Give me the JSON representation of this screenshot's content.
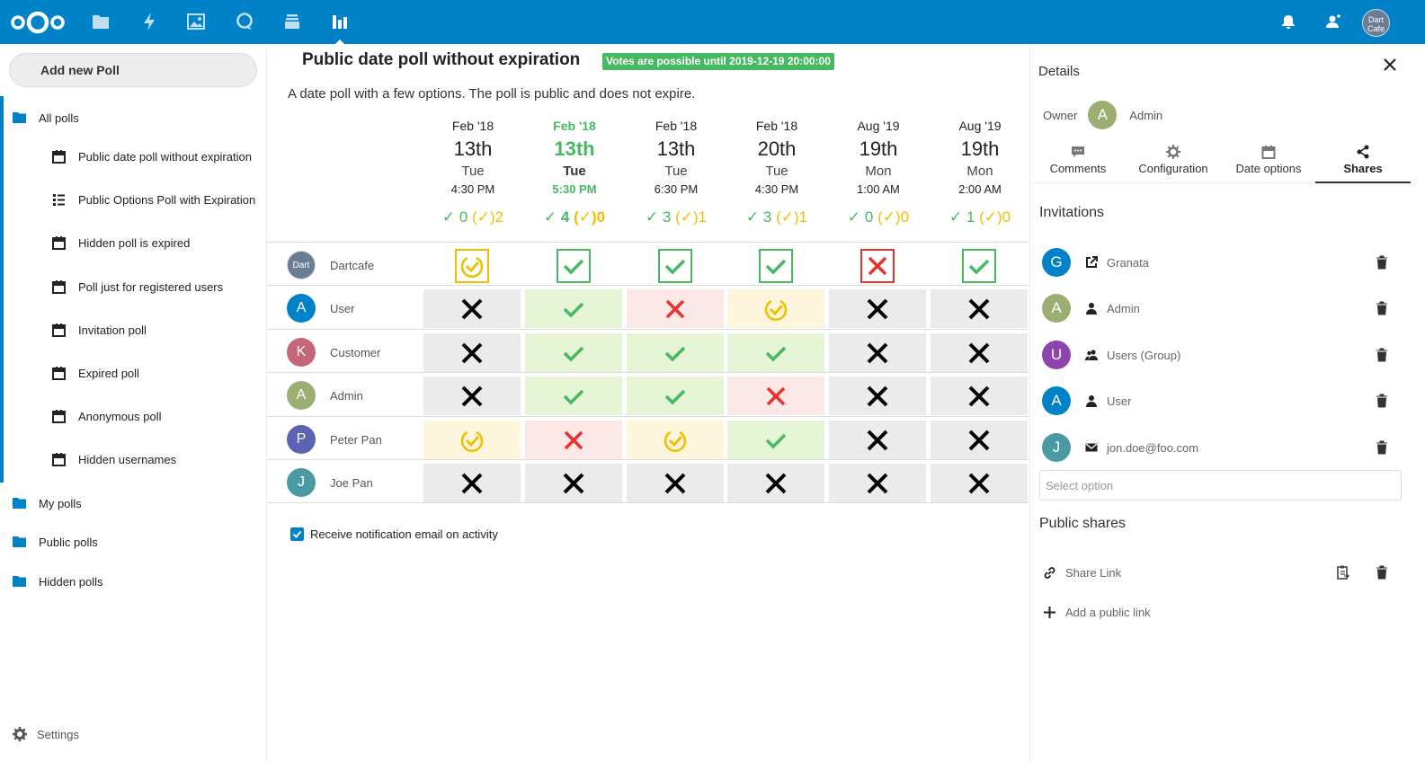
{
  "colors": {
    "brand": "#0082c9",
    "yes": "#46ba61",
    "maybe": "#f0c000",
    "no": "#e9322d"
  },
  "header": {
    "apps": [
      "files-icon",
      "activity-icon",
      "gallery-icon",
      "talk-icon",
      "deck-icon",
      "polls-icon"
    ],
    "user_avatar": "Dart Cafe"
  },
  "nav": {
    "add_label": "Add new Poll",
    "all_label": "All polls",
    "items": [
      {
        "label": "Public date poll without expiration",
        "icon": "calendar-icon"
      },
      {
        "label": "Public Options Poll with Expiration",
        "icon": "list-icon"
      },
      {
        "label": "Hidden poll is expired",
        "icon": "calendar-icon"
      },
      {
        "label": "Poll just for registered users",
        "icon": "calendar-icon"
      },
      {
        "label": "Invitation poll",
        "icon": "calendar-icon"
      },
      {
        "label": "Expired poll",
        "icon": "calendar-icon"
      },
      {
        "label": "Anonymous poll",
        "icon": "calendar-icon"
      },
      {
        "label": "Hidden usernames",
        "icon": "calendar-icon"
      }
    ],
    "my_label": "My polls",
    "public_label": "Public polls",
    "hidden_label": "Hidden polls",
    "settings_label": "Settings"
  },
  "poll": {
    "title": "Public date poll without expiration",
    "expiry_badge": "Votes are possible until 2019-12-19 20:00:00",
    "description": "A date poll with a few options. The poll is public and does not expire.",
    "options": [
      {
        "month": "Feb '18",
        "day": "13th",
        "dow": "Tue",
        "time": "4:30 PM",
        "yes": "0",
        "maybe": "2",
        "winner": false
      },
      {
        "month": "Feb '18",
        "day": "13th",
        "dow": "Tue",
        "time": "5:30 PM",
        "yes": "4",
        "maybe": "0",
        "winner": true
      },
      {
        "month": "Feb '18",
        "day": "13th",
        "dow": "Tue",
        "time": "6:30 PM",
        "yes": "3",
        "maybe": "1",
        "winner": false
      },
      {
        "month": "Feb '18",
        "day": "20th",
        "dow": "Tue",
        "time": "4:30 PM",
        "yes": "3",
        "maybe": "1",
        "winner": false
      },
      {
        "month": "Aug '19",
        "day": "19th",
        "dow": "Mon",
        "time": "1:00 AM",
        "yes": "0",
        "maybe": "0",
        "winner": false
      },
      {
        "month": "Aug '19",
        "day": "19th",
        "dow": "Mon",
        "time": "2:00 AM",
        "yes": "1",
        "maybe": "0",
        "winner": false
      }
    ],
    "participants": [
      {
        "name": "Dartcafe",
        "initial": "Dart",
        "color": "#6b7d95",
        "own": true,
        "votes": [
          "maybe",
          "yes",
          "yes",
          "yes",
          "no",
          "yes"
        ]
      },
      {
        "name": "User",
        "initial": "A",
        "color": "#0082c9",
        "own": false,
        "votes": [
          "none",
          "yes",
          "no",
          "maybe",
          "none",
          "none"
        ]
      },
      {
        "name": "Customer",
        "initial": "K",
        "color": "#c4657a",
        "own": false,
        "votes": [
          "none",
          "yes",
          "yes",
          "yes",
          "none",
          "none"
        ]
      },
      {
        "name": "Admin",
        "initial": "A",
        "color": "#9aaf71",
        "own": false,
        "votes": [
          "none",
          "yes",
          "yes",
          "no",
          "none",
          "none"
        ]
      },
      {
        "name": "Peter Pan",
        "initial": "P",
        "color": "#5c63b3",
        "own": false,
        "votes": [
          "maybe",
          "no",
          "maybe",
          "yes",
          "none",
          "none"
        ]
      },
      {
        "name": "Joe Pan",
        "initial": "J",
        "color": "#4a9aa3",
        "own": false,
        "votes": [
          "none",
          "none",
          "none",
          "none",
          "none",
          "none"
        ]
      }
    ],
    "notify_label": "Receive notification email on activity"
  },
  "sidebar": {
    "title": "Details",
    "owner_label": "Owner",
    "owner_initial": "A",
    "owner_name": "Admin",
    "tabs": [
      "Comments",
      "Configuration",
      "Date options",
      "Shares"
    ],
    "invitations_title": "Invitations",
    "shares": [
      {
        "name": "Granata",
        "initial": "G",
        "color": "#0082c9",
        "type": "external-icon"
      },
      {
        "name": "Admin",
        "initial": "A",
        "color": "#9aaf71",
        "type": "user-icon"
      },
      {
        "name": "Users (Group)",
        "initial": "U",
        "color": "#8e44ad",
        "type": "group-icon"
      },
      {
        "name": "User",
        "initial": "A",
        "color": "#0082c9",
        "type": "user-icon"
      },
      {
        "name": "jon.doe@foo.com",
        "initial": "J",
        "color": "#4a9aa3",
        "type": "mail-icon"
      }
    ],
    "select_placeholder": "Select option",
    "public_title": "Public shares",
    "share_link_label": "Share Link",
    "add_link_label": "Add a public link"
  }
}
